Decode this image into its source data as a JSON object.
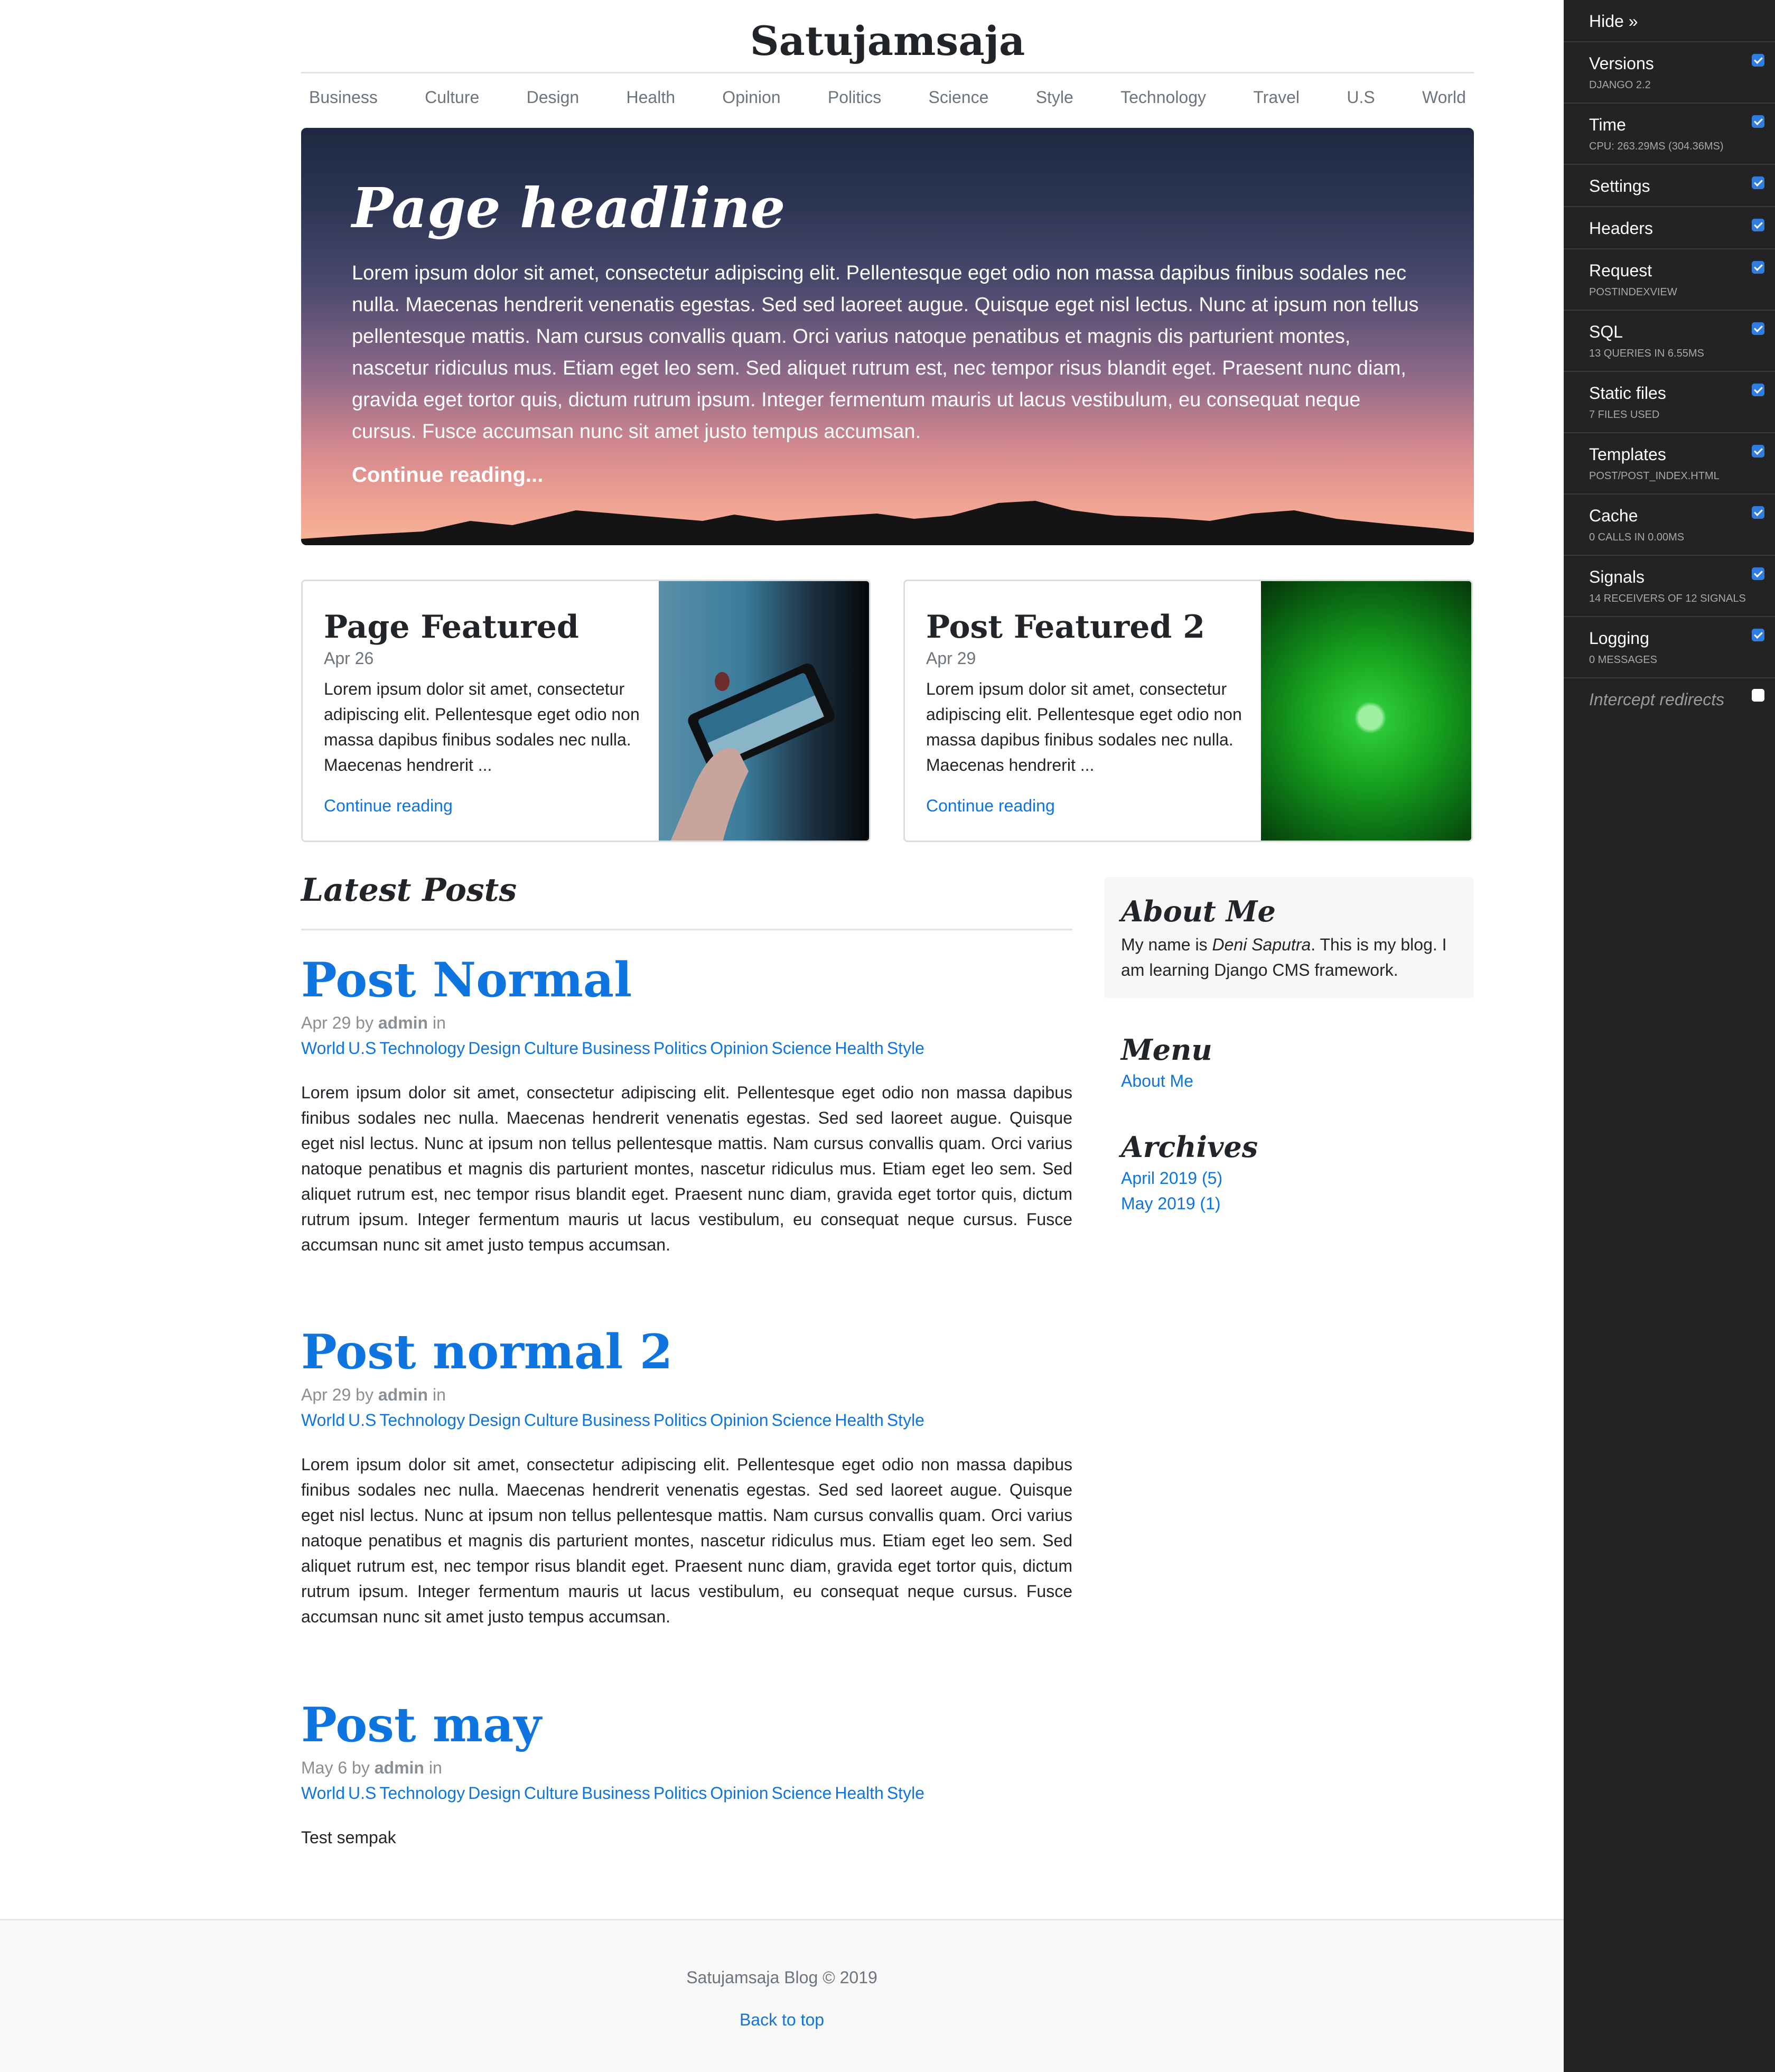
{
  "site": {
    "title": "Satujamsaja"
  },
  "nav": [
    "Business",
    "Culture",
    "Design",
    "Health",
    "Opinion",
    "Politics",
    "Science",
    "Style",
    "Technology",
    "Travel",
    "U.S",
    "World"
  ],
  "hero": {
    "title": "Page headline",
    "text": "Lorem ipsum dolor sit amet, consectetur adipiscing elit. Pellentesque eget odio non massa dapibus finibus sodales nec nulla. Maecenas hendrerit venenatis egestas. Sed sed laoreet augue. Quisque eget nisl lectus. Nunc at ipsum non tellus pellentesque mattis. Nam cursus convallis quam. Orci varius natoque penatibus et magnis dis parturient montes, nascetur ridiculus mus. Etiam eget leo sem. Sed aliquet rutrum est, nec tempor risus blandit eget. Praesent nunc diam, gravida eget tortor quis, dictum rutrum ipsum. Integer fermentum mauris ut lacus vestibulum, eu consequat neque cursus. Fusce accumsan nunc sit amet justo tempus accumsan.",
    "link": "Continue reading..."
  },
  "featured": [
    {
      "title": "Page Featured",
      "date": "Apr 26",
      "text": "Lorem ipsum dolor sit amet, consectetur adipiscing elit. Pellentesque eget odio non massa dapibus finibus sodales nec nulla. Maecenas hendrerit ...",
      "link": "Continue reading"
    },
    {
      "title": "Post Featured 2",
      "date": "Apr 29",
      "text": "Lorem ipsum dolor sit amet, consectetur adipiscing elit. Pellentesque eget odio non massa dapibus finibus sodales nec nulla. Maecenas hendrerit ...",
      "link": "Continue reading"
    }
  ],
  "latest": {
    "title": "Latest Posts",
    "by": "by",
    "in": "in",
    "categories": [
      "World",
      "U.S",
      "Technology",
      "Design",
      "Culture",
      "Business",
      "Politics",
      "Opinion",
      "Science",
      "Health",
      "Style"
    ],
    "posts": [
      {
        "title": "Post Normal",
        "date": "Apr 29",
        "author": "admin",
        "text": "Lorem ipsum dolor sit amet, consectetur adipiscing elit. Pellentesque eget odio non massa dapibus finibus sodales nec nulla. Maecenas hendrerit venenatis egestas. Sed sed laoreet augue. Quisque eget nisl lectus. Nunc at ipsum non tellus pellentesque mattis. Nam cursus convallis quam. Orci varius natoque penatibus et magnis dis parturient montes, nascetur ridiculus mus. Etiam eget leo sem. Sed aliquet rutrum est, nec tempor risus blandit eget. Praesent nunc diam, gravida eget tortor quis, dictum rutrum ipsum. Integer fermentum mauris ut lacus vestibulum, eu consequat neque cursus. Fusce accumsan nunc sit amet justo tempus accumsan."
      },
      {
        "title": "Post normal 2",
        "date": "Apr 29",
        "author": "admin",
        "text": "Lorem ipsum dolor sit amet, consectetur adipiscing elit. Pellentesque eget odio non massa dapibus finibus sodales nec nulla. Maecenas hendrerit venenatis egestas. Sed sed laoreet augue. Quisque eget nisl lectus. Nunc at ipsum non tellus pellentesque mattis. Nam cursus convallis quam. Orci varius natoque penatibus et magnis dis parturient montes, nascetur ridiculus mus. Etiam eget leo sem. Sed aliquet rutrum est, nec tempor risus blandit eget. Praesent nunc diam, gravida eget tortor quis, dictum rutrum ipsum. Integer fermentum mauris ut lacus vestibulum, eu consequat neque cursus. Fusce accumsan nunc sit amet justo tempus accumsan."
      },
      {
        "title": "Post may",
        "date": "May 6",
        "author": "admin",
        "text": "Test sempak"
      }
    ]
  },
  "sidebar": {
    "about": {
      "title": "About Me",
      "pre": "My name is ",
      "name": "Deni Saputra",
      "post": ". This is my blog. I am learning Django CMS framework."
    },
    "menu": {
      "title": "Menu",
      "items": [
        "About Me"
      ]
    },
    "archives": {
      "title": "Archives",
      "items": [
        "April 2019 (5)",
        "May 2019 (1)"
      ]
    }
  },
  "footer": {
    "text": "Satujamsaja Blog © 2019",
    "back_to_top": "Back to top"
  },
  "djdt": {
    "hide": "Hide »",
    "panels": [
      {
        "title": "Versions",
        "sub": "DJANGO 2.2",
        "checked": true
      },
      {
        "title": "Time",
        "sub": "CPU: 263.29MS (304.36MS)",
        "checked": true
      },
      {
        "title": "Settings",
        "sub": "",
        "checked": true
      },
      {
        "title": "Headers",
        "sub": "",
        "checked": true
      },
      {
        "title": "Request",
        "sub": "POSTINDEXVIEW",
        "checked": true
      },
      {
        "title": "SQL",
        "sub": "13 QUERIES IN 6.55MS",
        "checked": true
      },
      {
        "title": "Static files",
        "sub": "7 FILES USED",
        "checked": true
      },
      {
        "title": "Templates",
        "sub": "POST/POST_INDEX.HTML",
        "checked": true
      },
      {
        "title": "Cache",
        "sub": "0 CALLS IN 0.00MS",
        "checked": true
      },
      {
        "title": "Signals",
        "sub": "14 RECEIVERS OF 12 SIGNALS",
        "checked": true
      },
      {
        "title": "Logging",
        "sub": "0 MESSAGES",
        "checked": true
      }
    ],
    "intercept": {
      "label": "Intercept redirects",
      "checked": false
    }
  },
  "colors": {
    "link": "#0d74e0",
    "toolbar_bg": "#232323",
    "checkbox": "#2f7de1"
  }
}
